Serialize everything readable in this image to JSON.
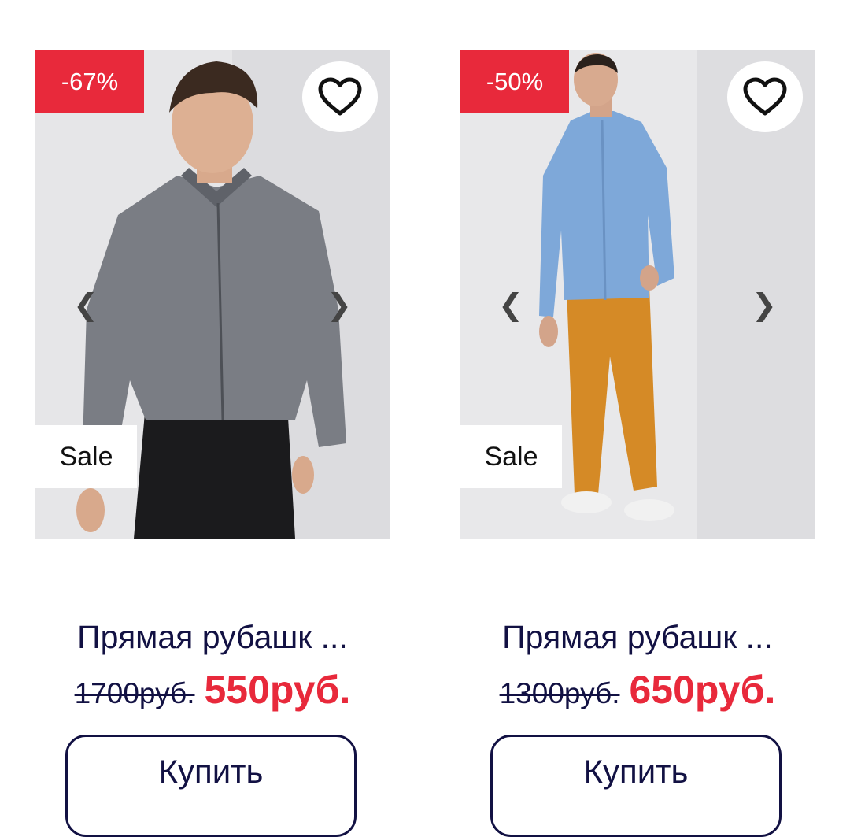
{
  "colors": {
    "accent": "#e8293b",
    "text": "#121143",
    "badge_text": "#ffffff"
  },
  "products": [
    {
      "discount": "-67%",
      "badge": "Sale",
      "title": "Прямая рубашк ...",
      "old_price": "1700руб.",
      "new_price": "550руб.",
      "buy_label": "Купить",
      "fav_icon": "heart-icon",
      "prev_icon": "chevron-left-icon",
      "next_icon": "chevron-right-icon",
      "prev_glyph": "❮",
      "next_glyph": "❯"
    },
    {
      "discount": "-50%",
      "badge": "Sale",
      "title": "Прямая рубашк ...",
      "old_price": "1300руб.",
      "new_price": "650руб.",
      "buy_label": "Купить",
      "fav_icon": "heart-icon",
      "prev_icon": "chevron-left-icon",
      "next_icon": "chevron-right-icon",
      "prev_glyph": "❮",
      "next_glyph": "❯"
    }
  ]
}
